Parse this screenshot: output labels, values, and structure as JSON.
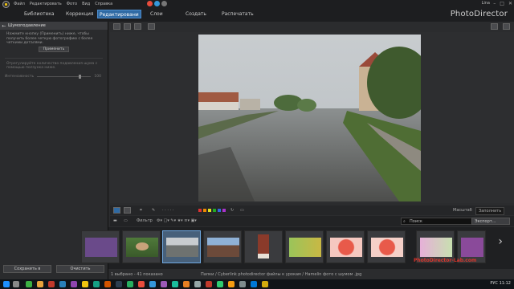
{
  "menu": [
    "Файл",
    "Редактировать",
    "Фото",
    "Вид",
    "Справка"
  ],
  "user": "Lina",
  "tabs": [
    {
      "label": "Библиотека",
      "active": false
    },
    {
      "label": "Коррекция",
      "active": false
    },
    {
      "label": "Редактировани",
      "active": true
    },
    {
      "label": "Слои",
      "active": false
    },
    {
      "label": "Создать",
      "active": false
    },
    {
      "label": "Распечатать",
      "active": false
    }
  ],
  "brand": "PhotoDirector",
  "panel": {
    "title": "Шумоподавление",
    "description": "Нажмите кнопку (Применить) ниже, чтобы получить более четкую фотографию с более четкими деталями.",
    "apply_label": "Применить",
    "secondary": "Отрегулируйте количество подавления шума с помощью ползунка ниже.",
    "slider_label": "Интенсивность",
    "slider_value": "100",
    "save_label": "Сохранить в",
    "clear_label": "Очистить"
  },
  "strip": {
    "zoom_label": "Масштаб",
    "zoom_value": "Заполнить",
    "filter_label": "Фильтр",
    "search_placeholder": "Поиск",
    "export_label": "Экспорт..."
  },
  "status": {
    "count": "1 выбрано - 41 показано",
    "path": "Папки / Cyberlink photodirector файлы к урокам / Hamelin фото с шумом .jpg"
  },
  "watermark": "PhotoDirector-Lab.com",
  "taskbar": {
    "lang": "РУС",
    "time": "11:12"
  },
  "colors": {
    "accent": "#2f6aa4",
    "swatches": [
      "#d33",
      "#e80",
      "#dd2",
      "#2a2",
      "#36d",
      "#a3c"
    ]
  }
}
